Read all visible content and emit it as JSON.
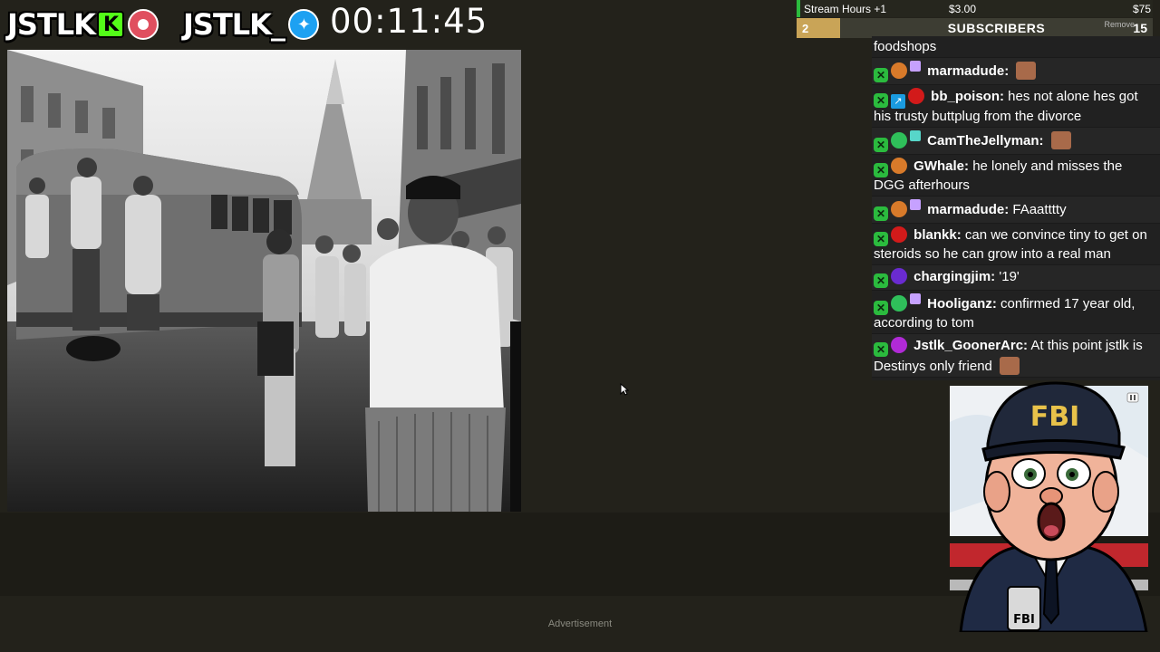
{
  "branding": {
    "kick_name": "JSTLK",
    "kick_icon": "kick-icon",
    "record_icon": "record-icon",
    "twitter_name": "JSTLK_",
    "twitter_icon": "twitter-icon"
  },
  "stream_timer": "00:11:45",
  "subathon": {
    "hours_label": "Stream Hours +1",
    "price_small": "$3.00",
    "price_large": "$75",
    "current_count": "2",
    "title": "SUBSCRIBERS",
    "remove_label": "Remove",
    "goal": "15"
  },
  "chat": {
    "truncated_top": "foodshops",
    "messages": [
      {
        "user": "marmadude:",
        "text": "",
        "user_color": "#ffffff",
        "badges": [
          "mod-icon",
          "orange-dot-icon",
          "gift-icon"
        ],
        "emote": "face-emote-icon"
      },
      {
        "user": "bb_poison:",
        "text": "hes not alone hes got his trusty buttplug from the divorce",
        "user_color": "#ffffff",
        "badges": [
          "mod-icon",
          "sword-icon",
          "red-dot-icon"
        ]
      },
      {
        "user": "CamTheJellyman:",
        "text": "",
        "user_color": "#ffffff",
        "badges": [
          "mod-icon",
          "green-dot-icon",
          "gift-icon"
        ],
        "emote": "face-emote-icon"
      },
      {
        "user": "GWhale:",
        "text": "he lonely and misses the DGG afterhours",
        "user_color": "#ffffff",
        "badges": [
          "mod-icon",
          "orange-dot-icon"
        ]
      },
      {
        "user": "marmadude:",
        "text": "FAaatttty",
        "user_color": "#ffffff",
        "badges": [
          "mod-icon",
          "orange-dot-icon",
          "gift-icon"
        ]
      },
      {
        "user": "blankk:",
        "text": "can we convince tiny to get on steroids so he can grow into a real man",
        "user_color": "#ffffff",
        "badges": [
          "mod-icon",
          "red-dot-icon"
        ]
      },
      {
        "user": "chargingjim:",
        "text": "'19'",
        "user_color": "#ffffff",
        "badges": [
          "mod-icon",
          "purple-dot-icon"
        ]
      },
      {
        "user": "Hooliganz:",
        "text": "confirmed 17 year old, according to tom",
        "user_color": "#ffffff",
        "badges": [
          "mod-icon",
          "green-dot-icon",
          "gift-icon"
        ]
      },
      {
        "user": "Jstlk_GoonerArc:",
        "text": "At this point jstlk is Destinys only friend",
        "user_color": "#ffffff",
        "badges": [
          "mod-icon",
          "magenta-dot-icon"
        ],
        "emote": "face-emote-icon"
      }
    ]
  },
  "cam_overlay": {
    "hat_text": "FBI",
    "badge_text": "FBI",
    "pause_icon": "pause-icon"
  },
  "footer": {
    "advertisement_label": "Advertisement"
  },
  "colors": {
    "page_bg": "#23221b",
    "mod_green": "#2bbb3e",
    "sub_gold": "#c9a457",
    "red_strip": "#c1272d"
  }
}
